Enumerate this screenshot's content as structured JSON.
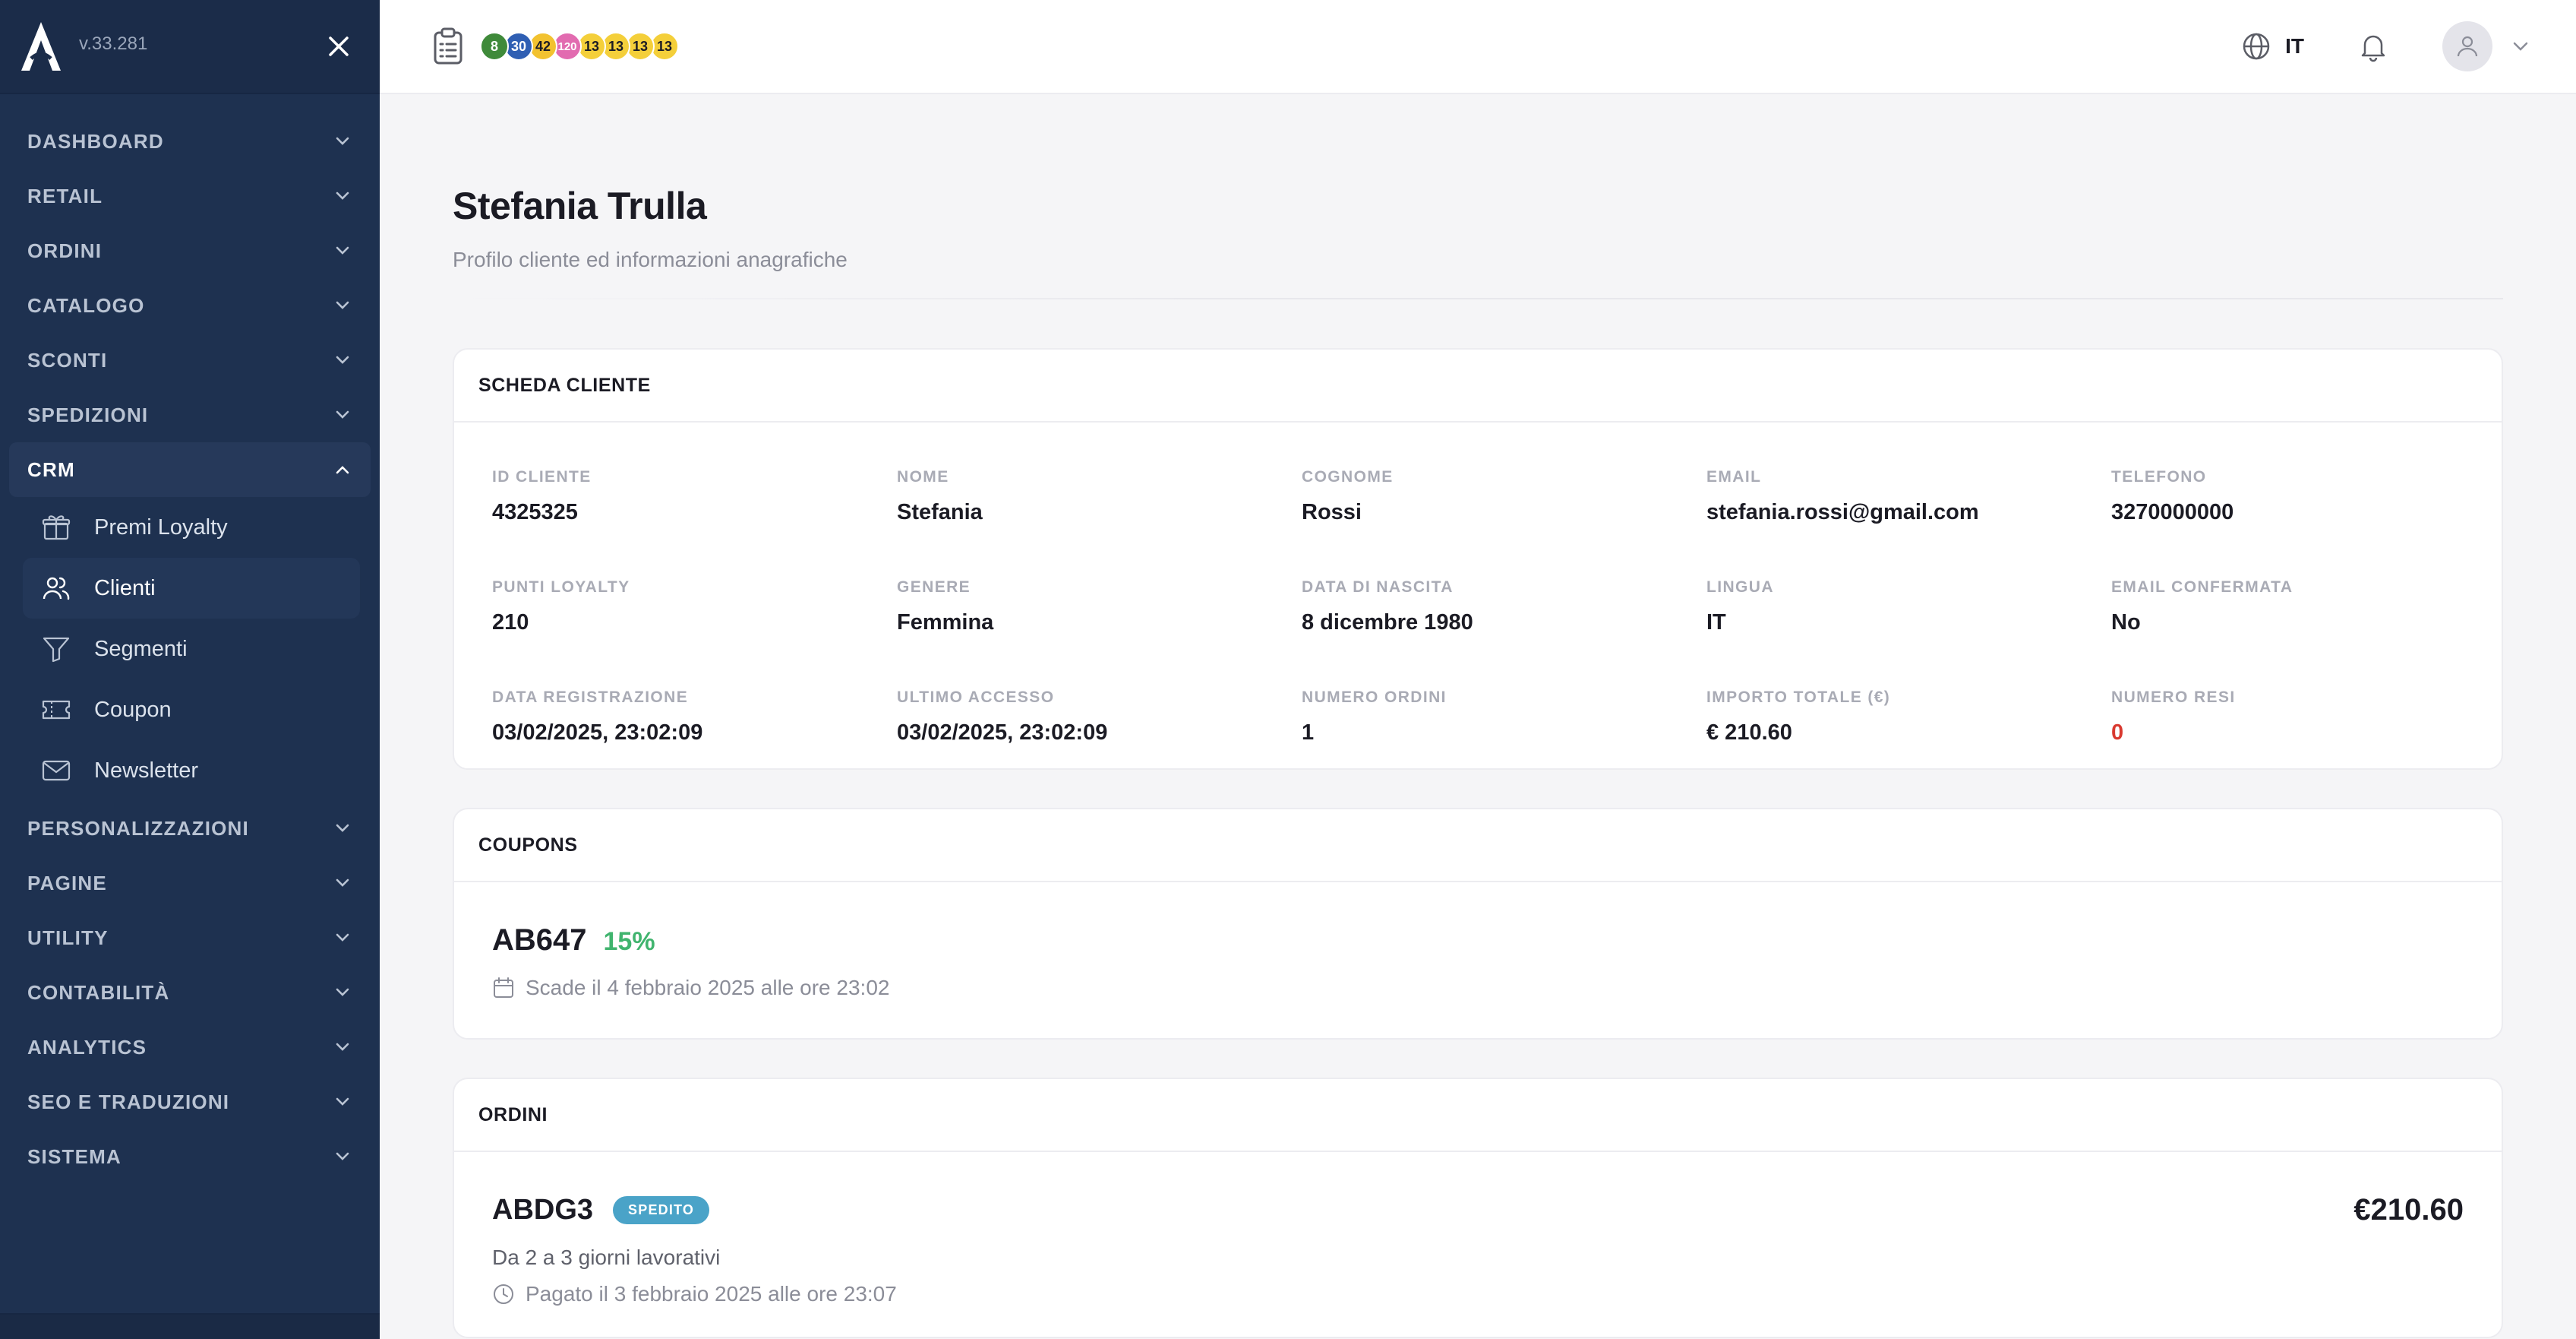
{
  "sidebar": {
    "version": "v.33.281",
    "items": [
      {
        "label": "DASHBOARD"
      },
      {
        "label": "RETAIL"
      },
      {
        "label": "ORDINI"
      },
      {
        "label": "CATALOGO"
      },
      {
        "label": "SCONTI"
      },
      {
        "label": "SPEDIZIONI"
      },
      {
        "label": "CRM"
      },
      {
        "label": "PERSONALIZZAZIONI"
      },
      {
        "label": "PAGINE"
      },
      {
        "label": "UTILITY"
      },
      {
        "label": "CONTABILITÀ"
      },
      {
        "label": "ANALYTICS"
      },
      {
        "label": "SEO E TRADUZIONI"
      },
      {
        "label": "SISTEMA"
      }
    ],
    "crm_children": [
      {
        "label": "Premi Loyalty",
        "icon": "gift-icon"
      },
      {
        "label": "Clienti",
        "icon": "users-icon"
      },
      {
        "label": "Segmenti",
        "icon": "filter-icon"
      },
      {
        "label": "Coupon",
        "icon": "ticket-icon"
      },
      {
        "label": "Newsletter",
        "icon": "mail-icon"
      }
    ]
  },
  "topbar": {
    "badges": [
      {
        "value": "8",
        "bg": "#3f8a3a",
        "fg": "#ffffff"
      },
      {
        "value": "30",
        "bg": "#2f5fb3",
        "fg": "#ffffff"
      },
      {
        "value": "42",
        "bg": "#f2c230",
        "fg": "#1b1b24"
      },
      {
        "value": "120",
        "bg": "#e26bb0",
        "fg": "#ffffff"
      },
      {
        "value": "13",
        "bg": "#f4cf3a",
        "fg": "#1b1b24"
      },
      {
        "value": "13",
        "bg": "#f4cf3a",
        "fg": "#1b1b24"
      },
      {
        "value": "13",
        "bg": "#f4cf3a",
        "fg": "#1b1b24"
      },
      {
        "value": "13",
        "bg": "#f4cf3a",
        "fg": "#1b1b24"
      }
    ],
    "language": "IT"
  },
  "page": {
    "title": "Stefania Trulla",
    "subtitle": "Profilo cliente ed informazioni anagrafiche"
  },
  "customer_card": {
    "title": "SCHEDA CLIENTE",
    "fields": [
      {
        "label": "ID CLIENTE",
        "value": "4325325"
      },
      {
        "label": "NOME",
        "value": "Stefania"
      },
      {
        "label": "COGNOME",
        "value": "Rossi"
      },
      {
        "label": "EMAIL",
        "value": "stefania.rossi@gmail.com"
      },
      {
        "label": "TELEFONO",
        "value": "3270000000"
      },
      {
        "label": "PUNTI LOYALTY",
        "value": "210"
      },
      {
        "label": "GENERE",
        "value": "Femmina"
      },
      {
        "label": "DATA DI NASCITA",
        "value": "8 dicembre 1980"
      },
      {
        "label": "LINGUA",
        "value": "IT"
      },
      {
        "label": "EMAIL CONFERMATA",
        "value": "No"
      },
      {
        "label": "DATA REGISTRAZIONE",
        "value": "03/02/2025, 23:02:09"
      },
      {
        "label": "ULTIMO ACCESSO",
        "value": "03/02/2025, 23:02:09"
      },
      {
        "label": "NUMERO ORDINI",
        "value": "1"
      },
      {
        "label": "IMPORTO TOTALE (€)",
        "value": "€ 210.60"
      },
      {
        "label": "NUMERO RESI",
        "value": "0"
      }
    ],
    "alert_color": "#d9392f"
  },
  "coupons_card": {
    "title": "COUPONS",
    "code": "AB647",
    "discount": "15%",
    "expiry": "Scade il 4 febbraio 2025 alle ore 23:02"
  },
  "orders_card": {
    "title": "ORDINI",
    "code": "ABDG3",
    "status": "SPEDITO",
    "total": "€210.60",
    "shipping": "Da 2 a 3 giorni lavorativi",
    "paid": "Pagato il 3 febbraio 2025 alle ore 23:07"
  }
}
